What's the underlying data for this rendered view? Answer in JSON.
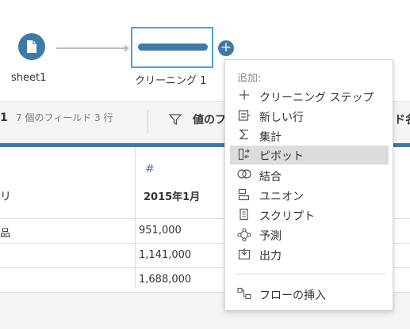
{
  "flow": {
    "input_node": {
      "label": "sheet1"
    },
    "clean_node": {
      "label": "クリーニング 1"
    },
    "add_button": "+"
  },
  "toolbar": {
    "step_number": "1",
    "fields_summary": "7 個のフィールド  3 行",
    "filter_label": "値のフ",
    "right_label": "ド名"
  },
  "grid": {
    "left_header": "リ",
    "type_icon": "#",
    "date_column_header": "2015年1月",
    "rows": [
      {
        "left": "品",
        "value": "951,000"
      },
      {
        "left": "",
        "value": "1,141,000"
      },
      {
        "left": "",
        "value": "1,688,000"
      }
    ]
  },
  "menu": {
    "header": "追加:",
    "items": [
      {
        "icon": "plus-icon",
        "label": "クリーニング ステップ"
      },
      {
        "icon": "new-rows-icon",
        "label": "新しい行"
      },
      {
        "icon": "sigma-icon",
        "label": "集計"
      },
      {
        "icon": "pivot-icon",
        "label": "ピボット",
        "highlighted": true
      },
      {
        "icon": "join-icon",
        "label": "結合"
      },
      {
        "icon": "union-icon",
        "label": "ユニオン"
      },
      {
        "icon": "script-icon",
        "label": "スクリプト"
      },
      {
        "icon": "predict-icon",
        "label": "予測"
      },
      {
        "icon": "output-icon",
        "label": "出力"
      }
    ],
    "insert_flow": {
      "icon": "insert-flow-icon",
      "label": "フローの挿入"
    }
  },
  "colors": {
    "accent": "#3e7aa5",
    "selection_border": "#4aa3df",
    "highlight": "#dcdcdc"
  }
}
